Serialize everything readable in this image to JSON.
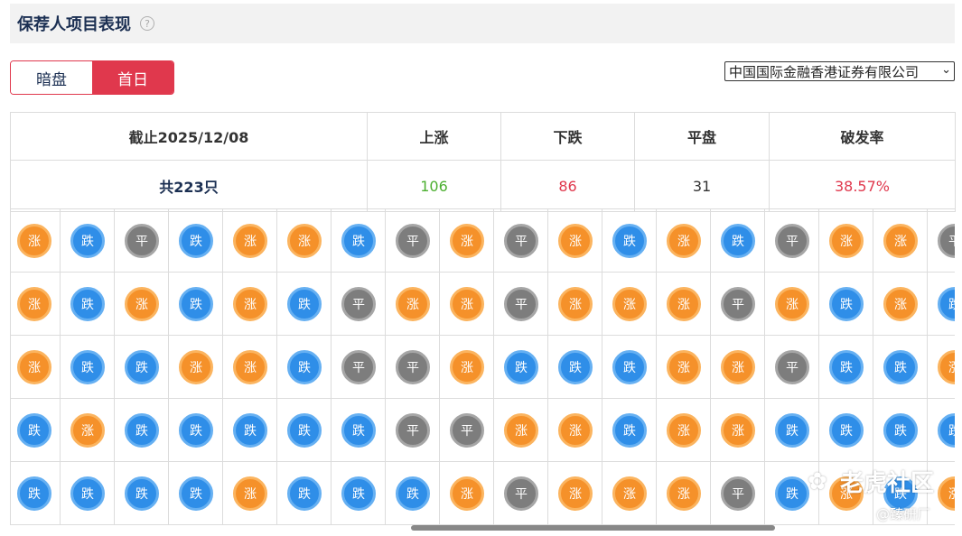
{
  "header": {
    "title": "保荐人项目表现",
    "help_glyph": "?"
  },
  "tabs": [
    {
      "label": "暗盘",
      "active": false
    },
    {
      "label": "首日",
      "active": true
    }
  ],
  "sponsor_select": {
    "selected": "中国国际金融香港证券有限公司"
  },
  "stats": {
    "headers": [
      "截止2025/12/08",
      "上涨",
      "下跌",
      "平盘",
      "破发率"
    ],
    "values": [
      "共223只",
      "106",
      "86",
      "31",
      "38.57%"
    ]
  },
  "badge_labels": {
    "up": "涨",
    "down": "跌",
    "flat": "平"
  },
  "grid": [
    [
      "up",
      "down",
      "flat",
      "down",
      "up",
      "up",
      "down",
      "flat",
      "up",
      "flat",
      "up",
      "down",
      "up",
      "down",
      "flat",
      "up",
      "up",
      "flat"
    ],
    [
      "up",
      "down",
      "up",
      "down",
      "up",
      "down",
      "flat",
      "up",
      "up",
      "flat",
      "up",
      "up",
      "up",
      "flat",
      "up",
      "down",
      "up",
      "down"
    ],
    [
      "up",
      "down",
      "down",
      "up",
      "up",
      "down",
      "flat",
      "flat",
      "up",
      "down",
      "down",
      "down",
      "up",
      "up",
      "flat",
      "down",
      "down",
      "up"
    ],
    [
      "down",
      "up",
      "down",
      "down",
      "down",
      "down",
      "down",
      "flat",
      "flat",
      "up",
      "up",
      "down",
      "up",
      "up",
      "down",
      "down",
      "down",
      "down"
    ],
    [
      "down",
      "down",
      "down",
      "down",
      "up",
      "down",
      "down",
      "down",
      "up",
      "flat",
      "up",
      "up",
      "up",
      "flat",
      "down",
      "up",
      "down",
      "up"
    ]
  ],
  "watermark": {
    "brand": "老虎社区",
    "handle": "@臻研厂"
  },
  "colors": {
    "accent": "#e0384d",
    "up": "#f5912a",
    "down": "#2f8ee8",
    "flat": "#7d7d7d",
    "rise_text": "#4caf30"
  }
}
